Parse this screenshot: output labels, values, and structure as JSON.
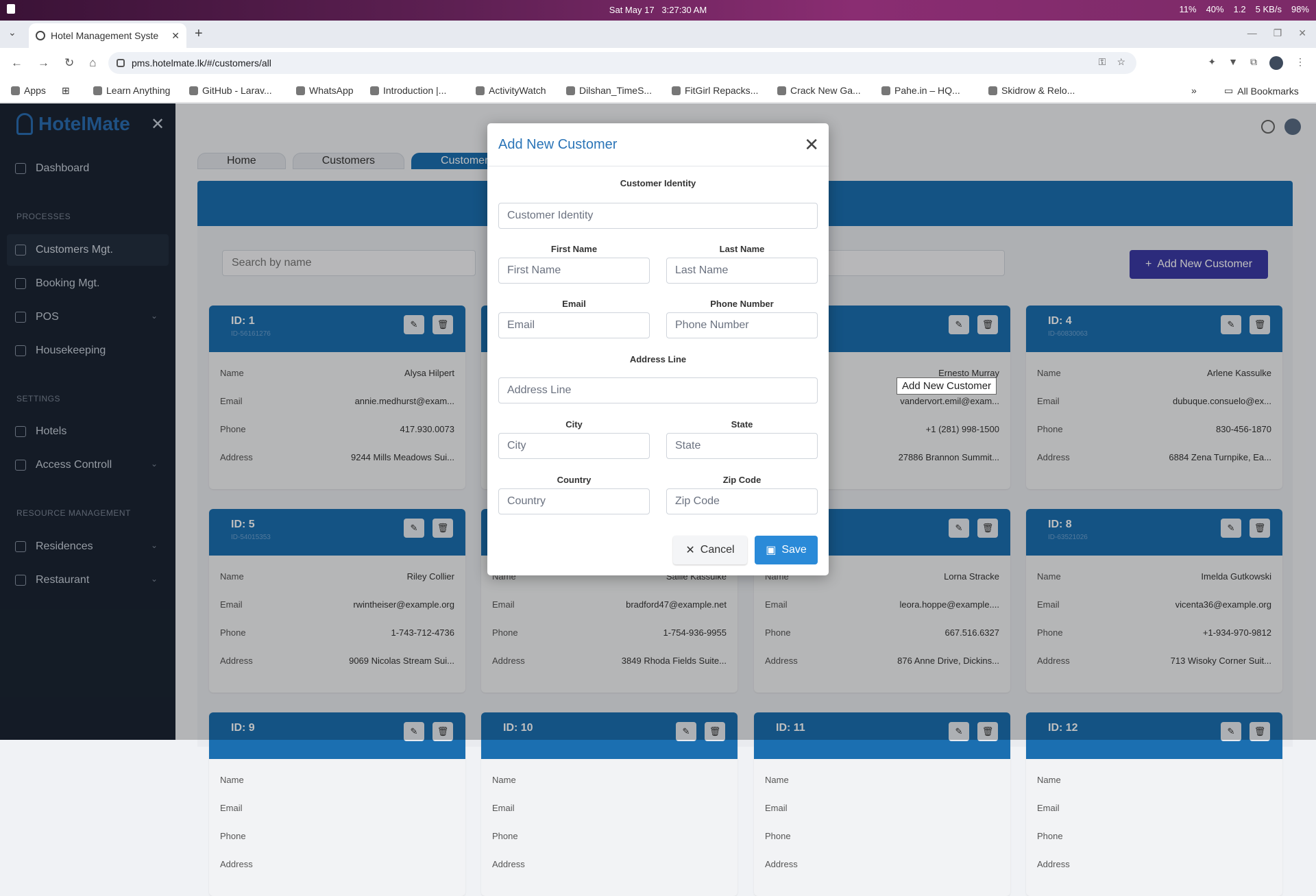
{
  "os": {
    "date": "Sat May 17",
    "time": "3:27:30 AM",
    "tray": [
      "11%",
      "40%",
      "1.2",
      "5 KB/s",
      "98%"
    ]
  },
  "browser": {
    "tab_title": "Hotel Management Syste",
    "url": "pms.hotelmate.lk/#/customers/all",
    "bookmarks": [
      "Apps",
      "Learn Anything",
      "GitHub - Larav...",
      "WhatsApp",
      "Introduction |...",
      "ActivityWatch",
      "Dilshan_TimeS...",
      "FitGirl Repacks...",
      "Crack New Ga...",
      "Pahe.in – HQ...",
      "Skidrow & Relo...",
      "All Bookmarks"
    ]
  },
  "sidebar": {
    "brand": "HotelMate",
    "items": [
      {
        "label": "Dashboard"
      },
      {
        "section": "PROCESSES"
      },
      {
        "label": "Customers Mgt."
      },
      {
        "label": "Booking Mgt."
      },
      {
        "label": "POS"
      },
      {
        "label": "Housekeeping"
      },
      {
        "section": "SETTINGS"
      },
      {
        "label": "Hotels"
      },
      {
        "label": "Access Controll"
      },
      {
        "section": "RESOURCE MANAGEMENT"
      },
      {
        "label": "Residences"
      },
      {
        "label": "Restaurant"
      }
    ]
  },
  "breadcrumbs": [
    "Home",
    "Customers",
    "Customers"
  ],
  "search_placeholder": "Search by name",
  "add_button": "Add New Customer",
  "tooltip": "Add New Customer",
  "field_labels": {
    "name": "Name",
    "email": "Email",
    "phone": "Phone",
    "address": "Address"
  },
  "cards": [
    {
      "id": "ID: 1",
      "code": "ID-56161276",
      "name": "Alysa Hilpert",
      "email": "annie.medhurst@exam...",
      "phone": "417.930.0073",
      "address": "9244 Mills Meadows Sui..."
    },
    {
      "id": "",
      "code": "",
      "name": "",
      "email": "",
      "phone": "",
      "address": ""
    },
    {
      "id": "",
      "code": "",
      "name": "Ernesto Murray",
      "email": "vandervort.emil@exam...",
      "phone": "+1 (281) 998-1500",
      "address": "27886 Brannon Summit..."
    },
    {
      "id": "ID: 4",
      "code": "ID-60830063",
      "name": "Arlene Kassulke",
      "email": "dubuque.consuelo@ex...",
      "phone": "830-456-1870",
      "address": "6884 Zena Turnpike, Ea..."
    },
    {
      "id": "ID: 5",
      "code": "ID-54015353",
      "name": "Riley Collier",
      "email": "rwintheiser@example.org",
      "phone": "1-743-712-4736",
      "address": "9069 Nicolas Stream Sui..."
    },
    {
      "id": "",
      "code": "",
      "name": "Sallie Kassulke",
      "email": "bradford47@example.net",
      "phone": "1-754-936-9955",
      "address": "3849 Rhoda Fields Suite..."
    },
    {
      "id": "",
      "code": "",
      "name": "Lorna Stracke",
      "email": "leora.hoppe@example....",
      "phone": "667.516.6327",
      "address": "876 Anne Drive, Dickins..."
    },
    {
      "id": "ID: 8",
      "code": "ID-63521026",
      "name": "Imelda Gutkowski",
      "email": "vicenta36@example.org",
      "phone": "+1-934-970-9812",
      "address": "713 Wisoky Corner Suit..."
    },
    {
      "id": "ID: 9",
      "code": "",
      "name": "",
      "email": "",
      "phone": "",
      "address": ""
    },
    {
      "id": "ID: 10",
      "code": "",
      "name": "",
      "email": "",
      "phone": "",
      "address": ""
    },
    {
      "id": "ID: 11",
      "code": "",
      "name": "",
      "email": "",
      "phone": "",
      "address": ""
    },
    {
      "id": "ID: 12",
      "code": "",
      "name": "",
      "email": "",
      "phone": "",
      "address": ""
    }
  ],
  "modal": {
    "title": "Add New Customer",
    "fields": {
      "identity": {
        "label": "Customer Identity",
        "placeholder": "Customer Identity"
      },
      "first_name": {
        "label": "First Name",
        "placeholder": "First Name"
      },
      "last_name": {
        "label": "Last Name",
        "placeholder": "Last Name"
      },
      "email": {
        "label": "Email",
        "placeholder": "Email"
      },
      "phone": {
        "label": "Phone Number",
        "placeholder": "Phone Number"
      },
      "address": {
        "label": "Address Line",
        "placeholder": "Address Line"
      },
      "city": {
        "label": "City",
        "placeholder": "City"
      },
      "state": {
        "label": "State",
        "placeholder": "State"
      },
      "country": {
        "label": "Country",
        "placeholder": "Country"
      },
      "zip": {
        "label": "Zip Code",
        "placeholder": "Zip Code"
      }
    },
    "cancel": "Cancel",
    "save": "Save"
  },
  "colors": {
    "brand_blue": "#1b6fb1",
    "add_button": "#3b3aa6",
    "save_button": "#2a8ad8",
    "sidebar_bg": "#1b2533"
  }
}
